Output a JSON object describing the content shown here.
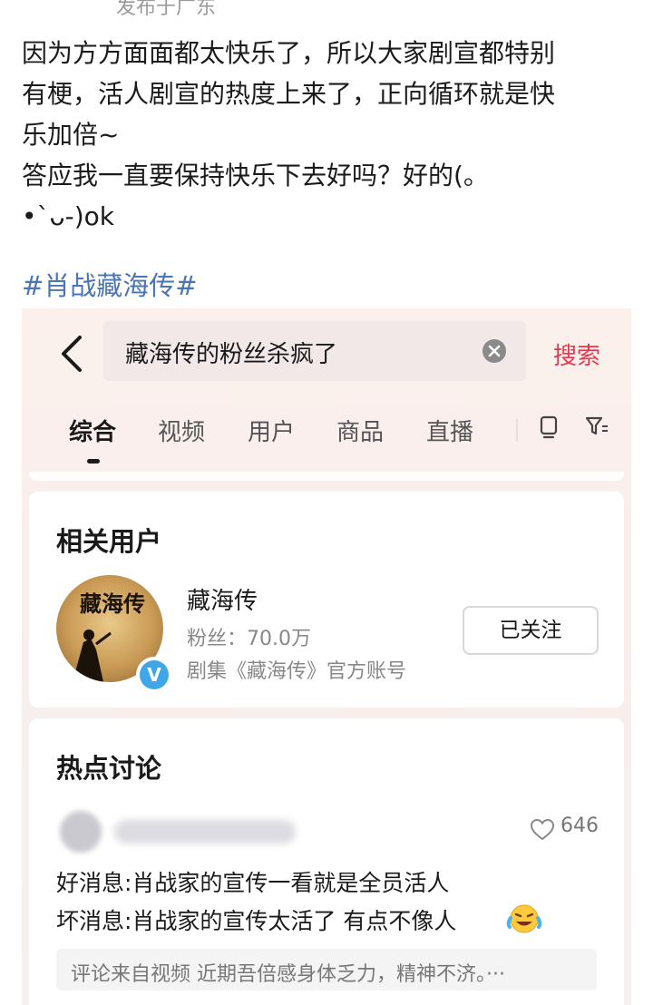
{
  "post": {
    "location_partial": "发布于广东",
    "lines": [
      "因为方方面面都太快乐了，所以大家剧宣都特别",
      "有梗，活人剧宣的热度上来了，正向循环就是快",
      "乐加倍~",
      "答应我一直要保持快乐下去好吗？好的(。",
      "•`ᴗ-)ok"
    ],
    "hashtag": "#肖战藏海传#"
  },
  "screenshot": {
    "search": {
      "query": "藏海传的粉丝杀疯了",
      "button": "搜索"
    },
    "tabs": [
      {
        "label": "综合",
        "active": true
      },
      {
        "label": "视频",
        "active": false
      },
      {
        "label": "用户",
        "active": false
      },
      {
        "label": "商品",
        "active": false
      },
      {
        "label": "直播",
        "active": false
      }
    ],
    "related_users": {
      "title": "相关用户",
      "user": {
        "name": "藏海传",
        "fans": "粉丝：70.0万",
        "desc": "剧集《藏海传》官方账号",
        "follow_label": "已关注",
        "verified_mark": "V",
        "avatar_text": "藏海传"
      }
    },
    "hot": {
      "title": "热点讨论",
      "comment": {
        "likes": "646",
        "lines": [
          "好消息:肖战家的宣传一看就是全员活人",
          "坏消息:肖战家的宣传太活了 有点不像人"
        ],
        "source": "评论来自视频 近期吾倍感身体乏力，精神不济。···"
      }
    },
    "colors": {
      "accent": "#e8364f",
      "hashtag": "#4a74b8",
      "verified": "#3fa7e8"
    }
  }
}
